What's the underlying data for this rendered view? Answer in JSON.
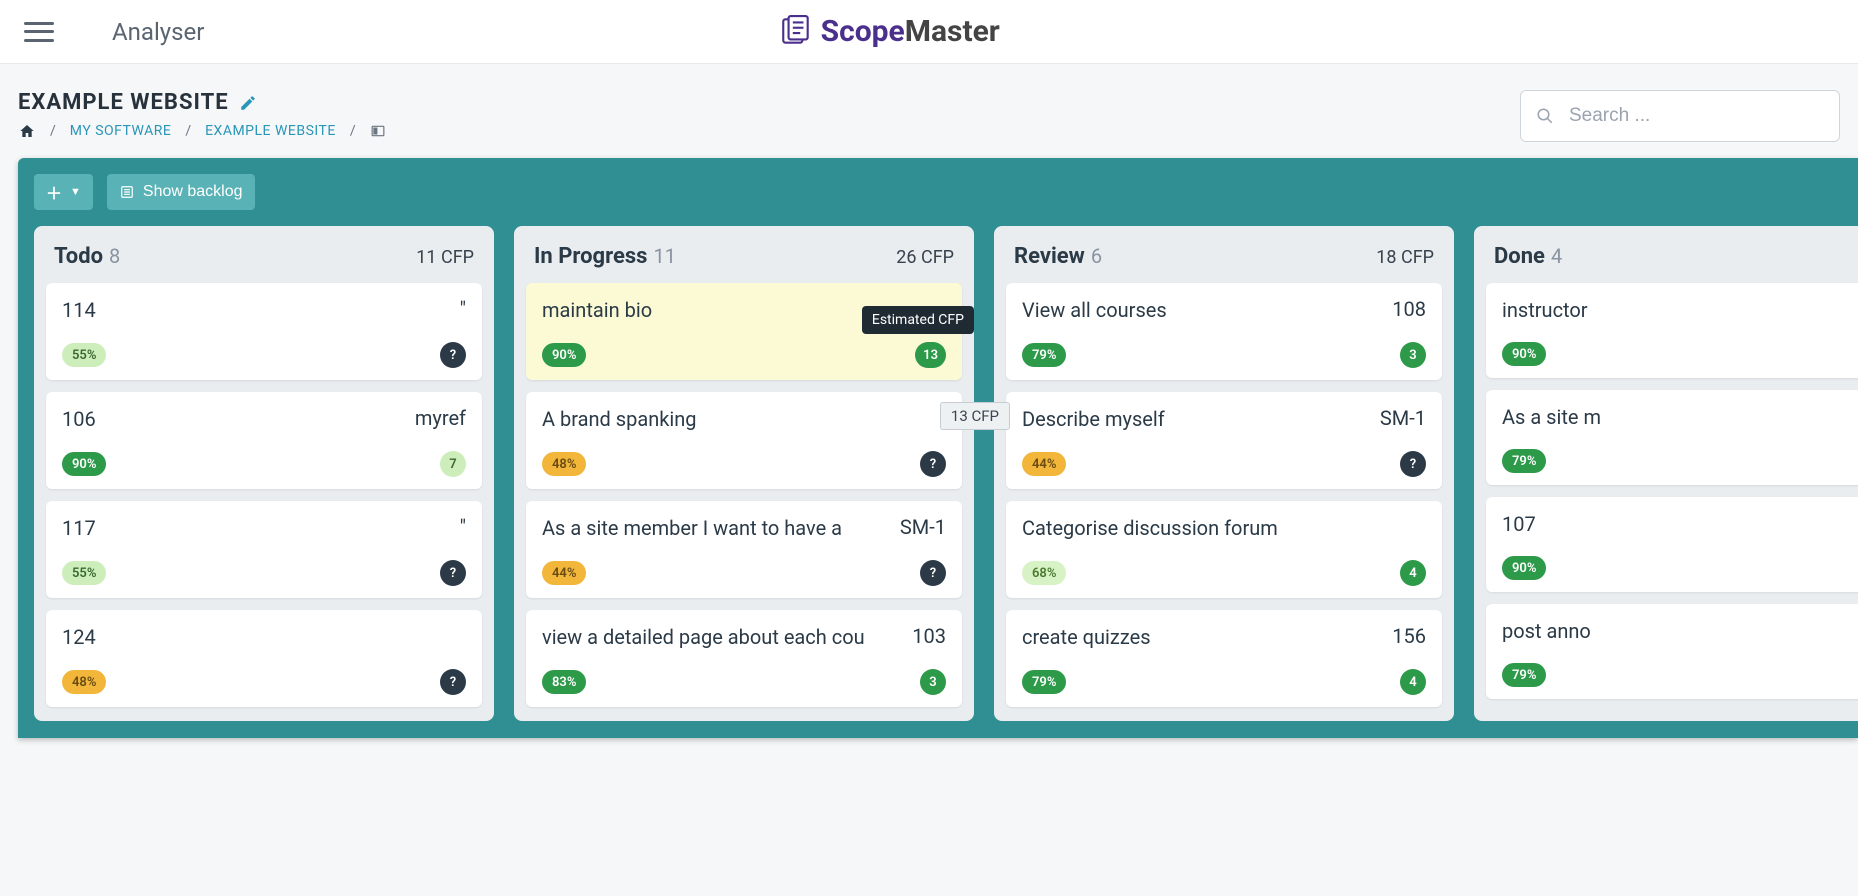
{
  "header": {
    "app_name": "Analyser",
    "logo_scope": "Scope",
    "logo_master": "Master"
  },
  "page": {
    "title": "EXAMPLE WEBSITE"
  },
  "breadcrumb": {
    "my_software": "MY SOFTWARE",
    "example_website": "EXAMPLE WEBSITE"
  },
  "search": {
    "placeholder": "Search ..."
  },
  "toolbar": {
    "show_backlog": "Show backlog"
  },
  "tooltip": {
    "estimated_cfp": "Estimated CFP",
    "float_cfp": "13 CFP"
  },
  "columns": [
    {
      "title": "Todo",
      "count": "8",
      "cfp": "11 CFP",
      "cards": [
        {
          "title": "114",
          "ref": "\"",
          "pct": "55%",
          "pct_cls": "pct-g",
          "badge": "?",
          "badge_cls": "q"
        },
        {
          "title": "106",
          "ref": "myref",
          "pct": "90%",
          "pct_cls": "pct-dg",
          "badge": "7",
          "badge_cls": "n-lg"
        },
        {
          "title": "117",
          "ref": "\"",
          "pct": "55%",
          "pct_cls": "pct-g",
          "badge": "?",
          "badge_cls": "q"
        },
        {
          "title": "124",
          "ref": "",
          "pct": "48%",
          "pct_cls": "pct-o",
          "badge": "?",
          "badge_cls": "q"
        }
      ]
    },
    {
      "title": "In Progress",
      "count": "11",
      "cfp": "26 CFP",
      "cards": [
        {
          "title": "maintain bio",
          "ref": "",
          "pct": "90%",
          "pct_cls": "pct-dg",
          "badge": "13",
          "badge_cls": "n-g",
          "hl": true,
          "tooltip": true
        },
        {
          "title": "A brand spanking",
          "ref": "",
          "pct": "48%",
          "pct_cls": "pct-o",
          "badge": "?",
          "badge_cls": "q"
        },
        {
          "title": "As a site member I want to have a",
          "ref": "SM-1",
          "pct": "44%",
          "pct_cls": "pct-o",
          "badge": "?",
          "badge_cls": "q"
        },
        {
          "title": "view a detailed page about each cou",
          "ref": "103",
          "pct": "83%",
          "pct_cls": "pct-dg",
          "badge": "3",
          "badge_cls": "n-g"
        }
      ]
    },
    {
      "title": "Review",
      "count": "6",
      "cfp": "18 CFP",
      "cards": [
        {
          "title": "View all courses",
          "ref": "108",
          "pct": "79%",
          "pct_cls": "pct-dg",
          "badge": "3",
          "badge_cls": "n-g"
        },
        {
          "title": "Describe myself",
          "ref": "SM-1",
          "pct": "44%",
          "pct_cls": "pct-o",
          "badge": "?",
          "badge_cls": "q"
        },
        {
          "title": "Categorise discussion forum",
          "ref": "",
          "pct": "68%",
          "pct_cls": "pct-lg",
          "badge": "4",
          "badge_cls": "n-g"
        },
        {
          "title": "create quizzes",
          "ref": "156",
          "pct": "79%",
          "pct_cls": "pct-dg",
          "badge": "4",
          "badge_cls": "n-g"
        }
      ]
    },
    {
      "title": "Done",
      "count": "4",
      "cfp": "",
      "cards": [
        {
          "title": "instructor",
          "ref": "",
          "pct": "90%",
          "pct_cls": "pct-dg",
          "badge": "",
          "badge_cls": ""
        },
        {
          "title": "As a site m",
          "ref": "",
          "pct": "79%",
          "pct_cls": "pct-dg",
          "badge": "",
          "badge_cls": ""
        },
        {
          "title": "107",
          "ref": "",
          "pct": "90%",
          "pct_cls": "pct-dg",
          "badge": "",
          "badge_cls": ""
        },
        {
          "title": "post anno",
          "ref": "",
          "pct": "79%",
          "pct_cls": "pct-dg",
          "badge": "",
          "badge_cls": ""
        }
      ]
    }
  ]
}
